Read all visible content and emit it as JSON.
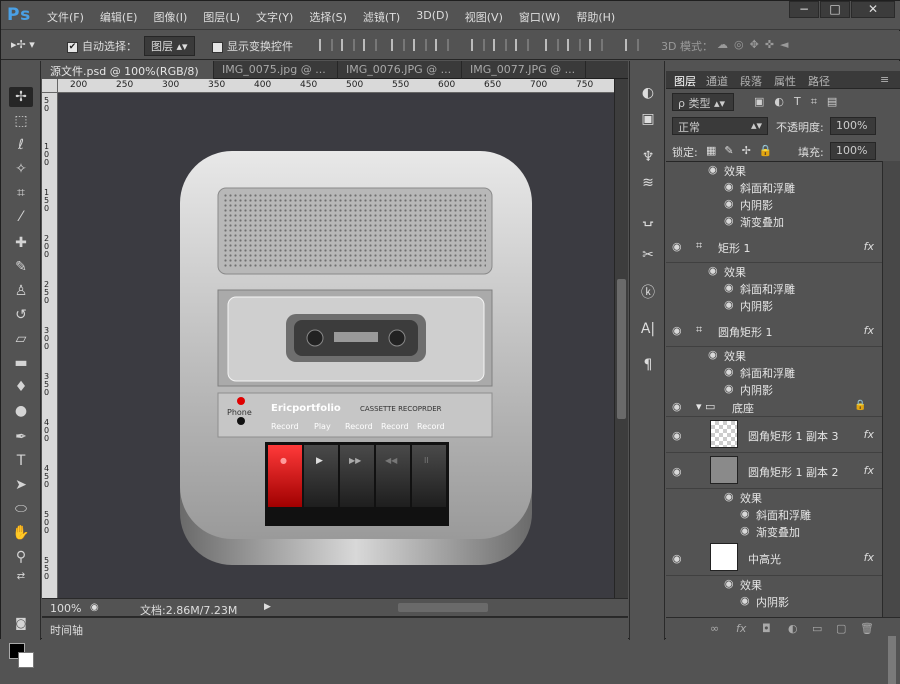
{
  "app": {
    "logo": "Ps"
  },
  "menu": [
    "文件(F)",
    "编辑(E)",
    "图像(I)",
    "图层(L)",
    "文字(Y)",
    "选择(S)",
    "滤镜(T)",
    "3D(D)",
    "视图(V)",
    "窗口(W)",
    "帮助(H)"
  ],
  "window_controls": {
    "minimize": "−",
    "maximize": "□",
    "close": "✕"
  },
  "options": {
    "auto_select_label": "自动选择：",
    "auto_select_value": "图层",
    "show_transform_label": "显示变换控件",
    "mode_3d_label": "3D 模式："
  },
  "doc_tabs": [
    "源文件.psd @ 100%(RGB/8) *",
    "IMG_0075.jpg @ ...",
    "IMG_0076.JPG @ ...",
    "IMG_0077.JPG @ ..."
  ],
  "ruler_h": [
    "200",
    "250",
    "300",
    "350",
    "400",
    "450",
    "500",
    "550",
    "600",
    "650",
    "700",
    "750"
  ],
  "ruler_v": [
    "50",
    "100",
    "150",
    "200",
    "250",
    "300",
    "350",
    "400",
    "450",
    "500",
    "550"
  ],
  "artwork": {
    "brand": "Ericportfolio",
    "model": "CASSETTE RECOPRDER",
    "phone": "Phone",
    "labels": [
      "Record",
      "Play",
      "Record",
      "Record",
      "Record"
    ],
    "buttons": [
      "●",
      "▶",
      "▶▶",
      "◀◀",
      "II"
    ]
  },
  "status": {
    "zoom": "100%",
    "doc_info": "文档:2.86M/7.23M"
  },
  "timeline_label": "时间轴",
  "panel": {
    "tabs": [
      "图层",
      "通道",
      "段落",
      "属性",
      "路径"
    ],
    "kind_label": "ρ 类型",
    "blend_mode": "正常",
    "opacity_label": "不透明度:",
    "opacity_value": "100%",
    "lock_label": "锁定:",
    "fill_label": "填充:",
    "fill_value": "100%"
  },
  "layers": [
    {
      "type": "sub",
      "text": "效果",
      "indent": 1
    },
    {
      "type": "sub",
      "text": "斜面和浮雕",
      "indent": 2
    },
    {
      "type": "sub",
      "text": "内阴影",
      "indent": 2
    },
    {
      "type": "sub",
      "text": "渐变叠加",
      "indent": 2
    },
    {
      "type": "layer",
      "text": "矩形 1",
      "fx": "fx"
    },
    {
      "type": "sub",
      "text": "效果",
      "indent": 1
    },
    {
      "type": "sub",
      "text": "斜面和浮雕",
      "indent": 2
    },
    {
      "type": "sub",
      "text": "内阴影",
      "indent": 2
    },
    {
      "type": "layer",
      "text": "圆角矩形 1",
      "fx": "fx"
    },
    {
      "type": "sub",
      "text": "效果",
      "indent": 1
    },
    {
      "type": "sub",
      "text": "斜面和浮雕",
      "indent": 2
    },
    {
      "type": "sub",
      "text": "内阴影",
      "indent": 2
    },
    {
      "type": "group",
      "text": "底座"
    },
    {
      "type": "thumb",
      "text": "圆角矩形 1 副本 3",
      "fx": "fx",
      "thumb": "checker"
    },
    {
      "type": "thumb",
      "text": "圆角矩形 1 副本 2",
      "fx": "fx",
      "thumb": "grey"
    },
    {
      "type": "sub",
      "text": "效果",
      "indent": 3
    },
    {
      "type": "sub",
      "text": "斜面和浮雕",
      "indent": 4
    },
    {
      "type": "sub",
      "text": "渐变叠加",
      "indent": 4
    },
    {
      "type": "thumb",
      "text": "中高光",
      "fx": "fx",
      "thumb": "white"
    },
    {
      "type": "sub",
      "text": "效果",
      "indent": 3
    },
    {
      "type": "sub",
      "text": "内阴影",
      "indent": 4
    }
  ]
}
